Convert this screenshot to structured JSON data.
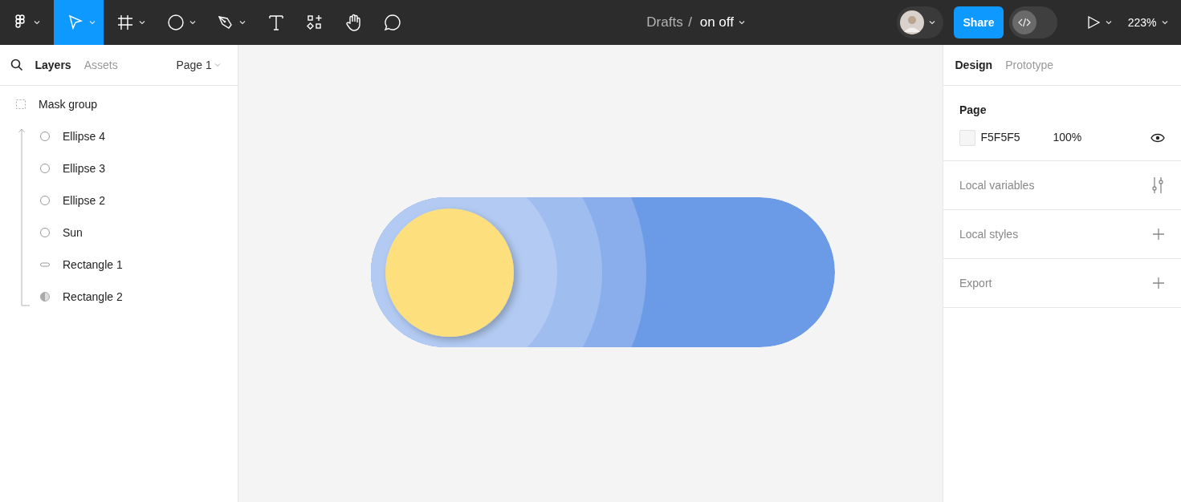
{
  "toolbar": {
    "tools": [
      {
        "kind": "logo",
        "selected": false,
        "has_menu": true
      },
      {
        "kind": "move",
        "selected": true,
        "has_menu": true
      },
      {
        "kind": "frame",
        "selected": false,
        "has_menu": true
      },
      {
        "kind": "shape",
        "selected": false,
        "has_menu": true
      },
      {
        "kind": "pen",
        "selected": false,
        "has_menu": true
      },
      {
        "kind": "text",
        "selected": false,
        "has_menu": false
      },
      {
        "kind": "resources",
        "selected": false,
        "has_menu": false
      },
      {
        "kind": "hand",
        "selected": false,
        "has_menu": false
      },
      {
        "kind": "comment",
        "selected": false,
        "has_menu": false
      }
    ],
    "breadcrumb": {
      "folder": "Drafts",
      "separator": "/",
      "file": "on off"
    },
    "share_button": "Share",
    "dev_mode": {
      "on": false
    },
    "zoom": "223%"
  },
  "left_panel": {
    "tabs": [
      {
        "label": "Layers",
        "selected": true
      },
      {
        "label": "Assets",
        "selected": false
      }
    ],
    "page_selector": "Page 1",
    "layers": [
      {
        "name": "Mask group",
        "kind": "mask",
        "children": [
          {
            "name": "Ellipse 4",
            "kind": "ellipse"
          },
          {
            "name": "Ellipse 3",
            "kind": "ellipse"
          },
          {
            "name": "Ellipse 2",
            "kind": "ellipse"
          },
          {
            "name": "Sun",
            "kind": "ellipse"
          },
          {
            "name": "Rectangle 1",
            "kind": "rectangle"
          },
          {
            "name": "Rectangle 2",
            "kind": "mask_shape"
          }
        ]
      }
    ]
  },
  "right_panel": {
    "tabs": [
      {
        "label": "Design",
        "selected": true
      },
      {
        "label": "Prototype",
        "selected": false
      }
    ],
    "page": {
      "title": "Page",
      "fill": "F5F5F5",
      "opacity": "100%",
      "visible": true
    },
    "sections": [
      {
        "title": "Local variables",
        "kind": "variables"
      },
      {
        "title": "Local styles",
        "kind": "add"
      },
      {
        "title": "Export",
        "kind": "add"
      }
    ]
  }
}
